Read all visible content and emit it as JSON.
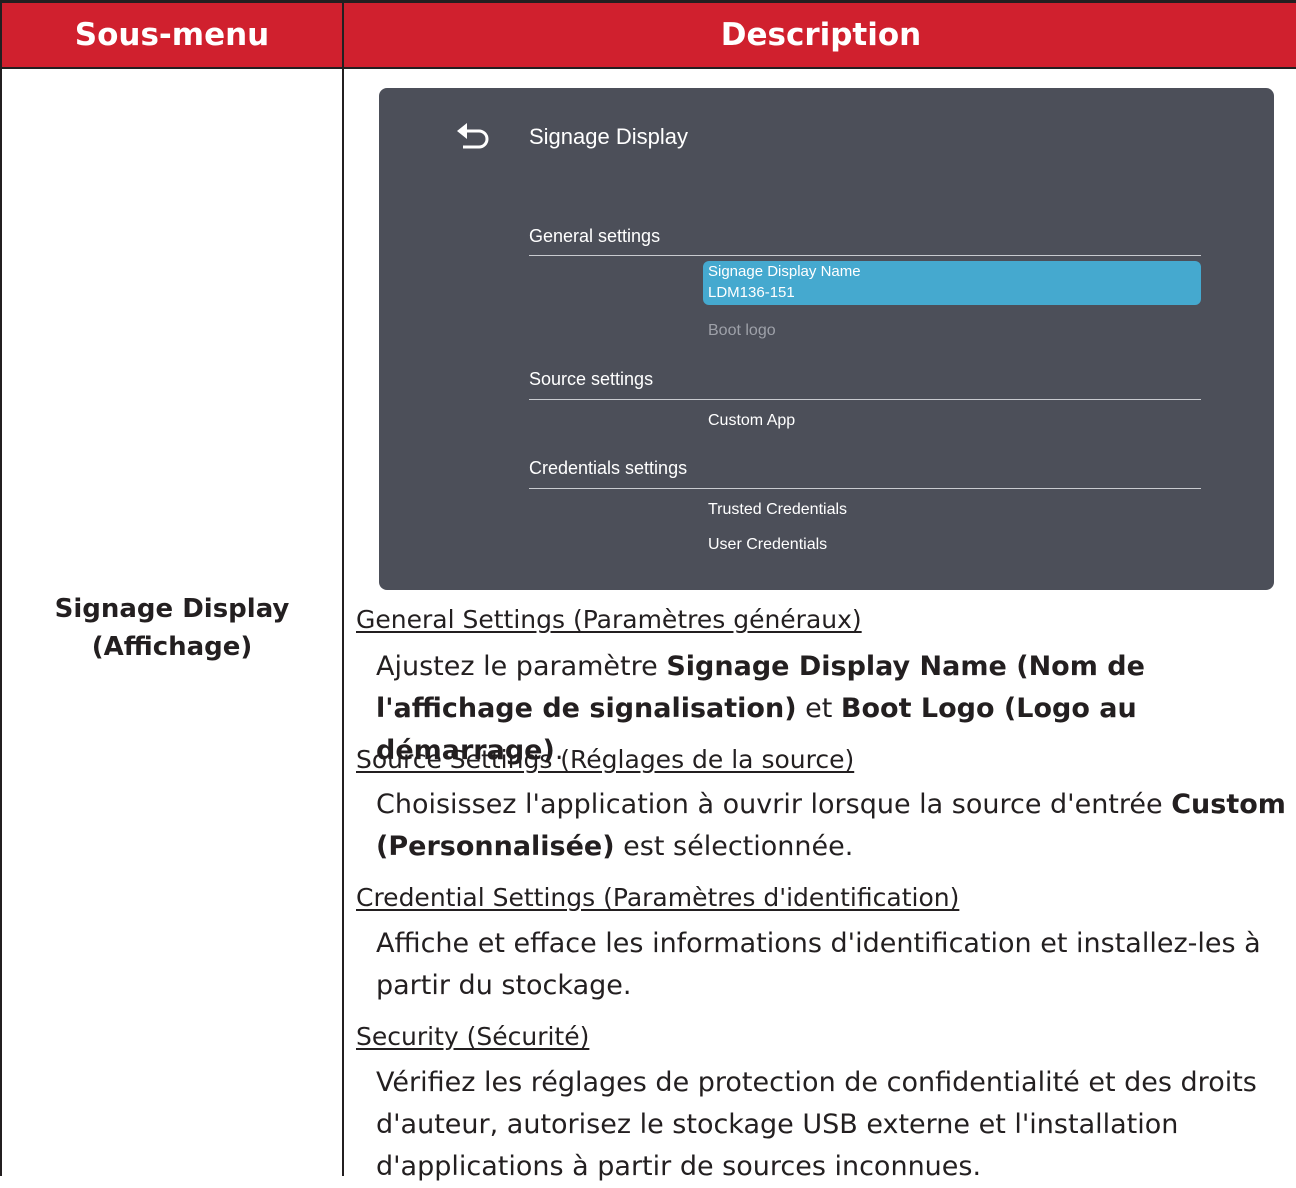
{
  "table": {
    "header": {
      "left": "Sous-menu",
      "right": "Description"
    },
    "submenu": {
      "line1": "Signage Display",
      "line2": "(Affichage)"
    }
  },
  "screen": {
    "title": "Signage Display",
    "general": {
      "title": "General settings",
      "selected_item": {
        "label": "Signage Display Name",
        "value": "LDM136-151"
      },
      "boot_logo": "Boot logo"
    },
    "source": {
      "title": "Source settings",
      "custom_app": "Custom App"
    },
    "credentials": {
      "title": "Credentials settings",
      "trusted": "Trusted Credentials",
      "user": "User Credentials"
    },
    "colors": {
      "panel_bg": "#4c4f59",
      "highlight": "#45a9cf"
    }
  },
  "descriptions": {
    "general": {
      "heading": "General Settings (Paramètres généraux)",
      "t1": "Ajustez le paramètre ",
      "b1": "Signage Display Name (Nom de l'affichage de signalisation)",
      "t2": " et ",
      "b2": "Boot Logo (Logo au démarrage)",
      "t3": "."
    },
    "source": {
      "heading": "Source Settings (Réglages de la source)",
      "t1": "Choisissez l'application à ouvrir lorsque la source d'entrée ",
      "b1": "Custom (Personnalisée)",
      "t2": " est sélectionnée."
    },
    "credential": {
      "heading": "Credential Settings (Paramètres d'identification)",
      "t1": "Affiche et efface les informations d'identification et installez-les à partir du stockage."
    },
    "security": {
      "heading": "Security (Sécurité)",
      "t1": "Vérifiez les réglages de protection de confidentialité et des droits d'auteur, autorisez le stockage USB externe et l'installation d'applications à partir de sources inconnues."
    }
  },
  "header_color": "#d0202e"
}
